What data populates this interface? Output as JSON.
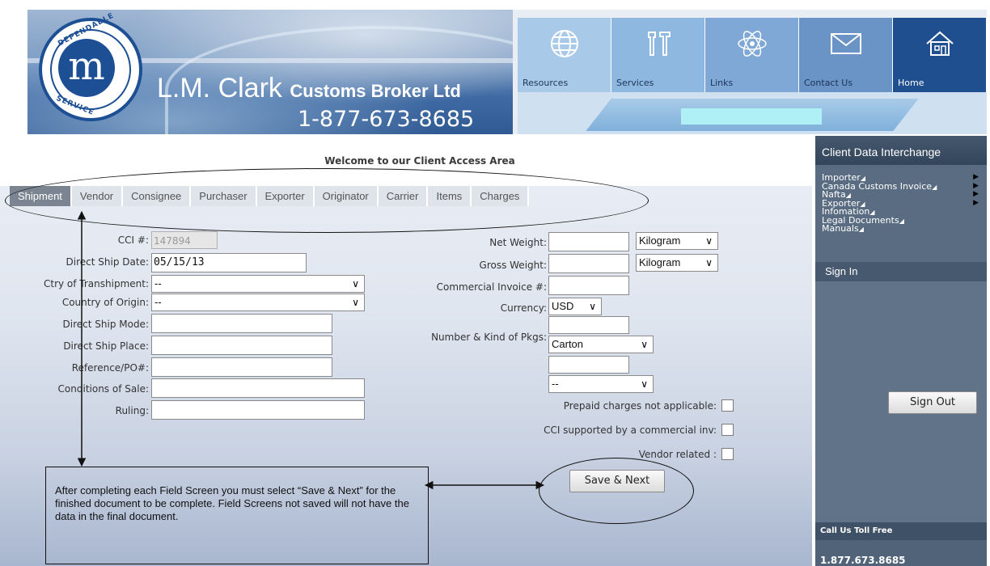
{
  "header": {
    "logo_top": "DEPENDABLE",
    "logo_bottom": "SERVICE",
    "logo_letter": "m",
    "company_name": "L.M. Clark",
    "company_sub": "Customs Broker Ltd",
    "phone": "1-877-673-8685"
  },
  "nav": [
    {
      "label": "Resources",
      "icon": "globe-icon"
    },
    {
      "label": "Services",
      "icon": "tools-icon"
    },
    {
      "label": "Links",
      "icon": "atom-icon"
    },
    {
      "label": "Contact Us",
      "icon": "envelope-icon"
    },
    {
      "label": "Home",
      "icon": "house-icon"
    }
  ],
  "welcome": "Welcome to our Client Access Area",
  "tabs": [
    "Shipment",
    "Vendor",
    "Consignee",
    "Purchaser",
    "Exporter",
    "Originator",
    "Carrier",
    "Items",
    "Charges"
  ],
  "form": {
    "cci_label": "CCI #:",
    "cci_value": "147894",
    "direct_ship_date_label": "Direct Ship Date:",
    "direct_ship_date_value": "05/15/13",
    "transhipment_label": "Ctry of Transhipment:",
    "transhipment_value": "--",
    "origin_label": "Country of Origin:",
    "origin_value": "--",
    "ship_mode_label": "Direct Ship Mode:",
    "ship_place_label": "Direct Ship Place:",
    "reference_label": "Reference/PO#:",
    "conditions_label": "Conditions of Sale:",
    "ruling_label": "Ruling:",
    "net_weight_label": "Net Weight:",
    "net_weight_unit": "Kilogram",
    "gross_weight_label": "Gross Weight:",
    "gross_weight_unit": "Kilogram",
    "commercial_invoice_label": "Commercial Invoice #:",
    "currency_label": "Currency:",
    "currency_value": "USD",
    "pkgs_label": "Number & Kind of Pkgs:",
    "pkgs_kind": "Carton",
    "extra_select": "--",
    "prepaid_label": "Prepaid charges not applicable:",
    "cci_supported_label": "CCI supported by a commercial inv:",
    "vendor_related_label": "Vendor related :",
    "save_next": "Save & Next",
    "chevron": "∨"
  },
  "callout": "After completing each Field Screen you must select “Save & Next” for the finished document to be complete. Field Screens not saved will not have the data in the final document.",
  "sidebar": {
    "title": "Client Data Interchange",
    "items": [
      "Importer",
      "Canada Customs Invoice",
      "Nafta",
      "Exporter",
      "Infomation",
      "Legal Documents",
      "Manuals"
    ],
    "caret": "◢",
    "arrow": "▶",
    "sign_in": "Sign In",
    "sign_out": "Sign Out",
    "call_title": "Call Us Toll Free",
    "call_phone": "1.877.673.8685"
  }
}
